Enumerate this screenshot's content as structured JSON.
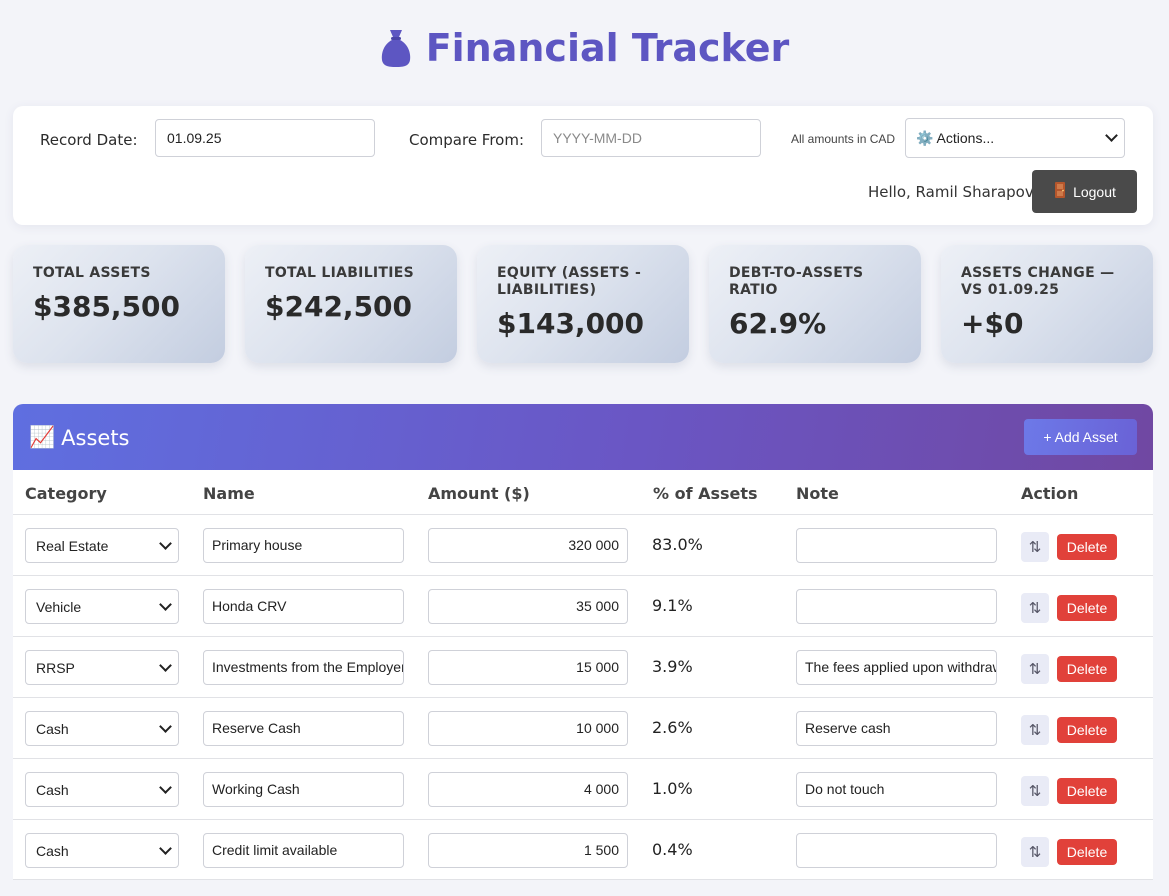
{
  "header": {
    "title": "Financial Tracker",
    "icon": "money-bag-icon"
  },
  "toolbar": {
    "record_date_label": "Record Date:",
    "record_date_value": "01.09.25",
    "compare_from_label": "Compare From:",
    "compare_from_placeholder": "YYYY-MM-DD",
    "currency_note": "All amounts in CAD",
    "actions_select": "⚙️ Actions...",
    "greeting": "Hello, Ramil Sharapov",
    "logout_label": "Logout"
  },
  "summary": [
    {
      "label": "TOTAL ASSETS",
      "value": "$385,500"
    },
    {
      "label": "TOTAL LIABILITIES",
      "value": "$242,500"
    },
    {
      "label": "EQUITY (ASSETS - LIABILITIES)",
      "value": "$143,000"
    },
    {
      "label": "DEBT-TO-ASSETS RATIO",
      "value": "62.9%"
    },
    {
      "label": "ASSETS CHANGE — VS 01.09.25",
      "value": "+$0"
    }
  ],
  "assets": {
    "title": "Assets",
    "title_icon": "📈",
    "add_button": "+ Add Asset",
    "columns": [
      "Category",
      "Name",
      "Amount ($)",
      "% of Assets",
      "Note",
      "Action"
    ],
    "delete_label": "Delete",
    "sort_glyph": "⇅",
    "rows": [
      {
        "category": "Real Estate",
        "name": "Primary house",
        "amount": "320 000",
        "pct": "83.0%",
        "note": ""
      },
      {
        "category": "Vehicle",
        "name": "Honda CRV",
        "amount": "35 000",
        "pct": "9.1%",
        "note": ""
      },
      {
        "category": "RRSP",
        "name": "Investments from the Employer",
        "amount": "15 000",
        "pct": "3.9%",
        "note": "The fees applied upon withdrawal"
      },
      {
        "category": "Cash",
        "name": "Reserve Cash",
        "amount": "10 000",
        "pct": "2.6%",
        "note": "Reserve cash"
      },
      {
        "category": "Cash",
        "name": "Working Cash",
        "amount": "4 000",
        "pct": "1.0%",
        "note": "Do not touch"
      },
      {
        "category": "Cash",
        "name": "Credit limit available",
        "amount": "1 500",
        "pct": "0.4%",
        "note": ""
      }
    ]
  },
  "colors": {
    "accent": "#5d56c2",
    "delete": "#e1413a",
    "logout": "#4a4a4a"
  }
}
